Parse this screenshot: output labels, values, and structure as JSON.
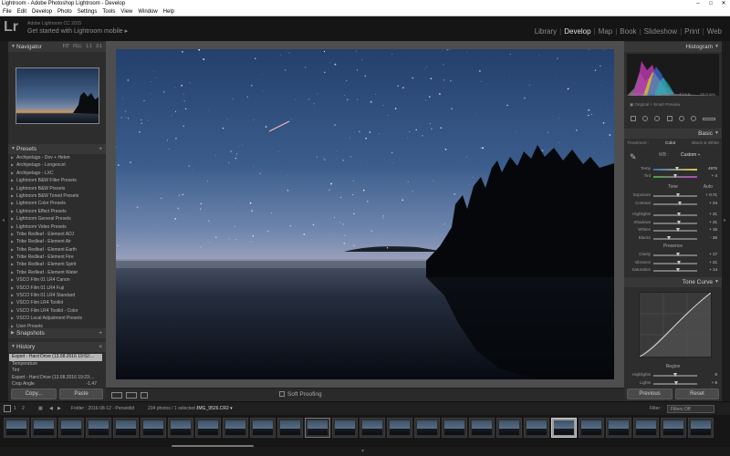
{
  "window": {
    "title": "Lightroom - Adobe Photoshop Lightroom - Develop",
    "controls": [
      "–",
      "□",
      "✕"
    ]
  },
  "menu": [
    "File",
    "Edit",
    "Develop",
    "Photo",
    "Settings",
    "Tools",
    "View",
    "Window",
    "Help"
  ],
  "identity": {
    "logo": "Lr",
    "product": "Adobe Lightroom CC 2015",
    "subtitle": "Get started with Lightroom mobile ▸"
  },
  "modules": [
    "Library",
    "Develop",
    "Map",
    "Book",
    "Slideshow",
    "Print",
    "Web"
  ],
  "active_module": "Develop",
  "left": {
    "navigator": {
      "title": "Navigator",
      "options": [
        "FIT",
        "FILL",
        "1:1",
        "3:1"
      ]
    },
    "presets_title": "Presets",
    "presets": [
      "Archipelago - Dov + Helen",
      "Archipelago - Longexcel",
      "Archipelago - LXC",
      "Lightroom B&W Filter Presets",
      "Lightroom B&W Presets",
      "Lightroom B&W Toned Presets",
      "Lightroom Color Presets",
      "Lightroom Effect Presets",
      "Lightroom General Presets",
      "Lightroom Video Presets",
      "Tribe Redleaf - Element ADJ",
      "Tribe Redleaf - Element Air",
      "Tribe Redleaf - Element Earth",
      "Tribe Redleaf - Element Fire",
      "Tribe Redleaf - Element Spirit",
      "Tribe Redleaf - Element Water",
      "VSCO Film 01 LR4 Canon",
      "VSCO Film 01 LR4 Fuji",
      "VSCO Film 01 LR4 Standard",
      "VSCO Film LR4 Toolkit",
      "VSCO Film LR4 Toolkit - Color",
      "VSCO Local Adjustment Presets",
      "User Presets"
    ],
    "snapshots_title": "Snapshots",
    "history_title": "History",
    "history": [
      "Export - Hard Drive (13.08.2016 19:52:...",
      "Temperature",
      "Tint",
      "Export - Hard Drive (13.08.2016 19:23:...",
      "Crop Angle"
    ],
    "history_values": [
      "",
      "",
      "",
      "",
      "-1.47"
    ],
    "copy_label": "Copy...",
    "paste_label": "Paste"
  },
  "toolbar": {
    "soft_proofing": "Soft Proofing"
  },
  "right": {
    "histogram_title": "Histogram",
    "histo_info": [
      "ISO 3200",
      "14 mm",
      "f / 2.8",
      "15.0 sec"
    ],
    "preview_label": "Original + Smart Preview",
    "basic_title": "Basic",
    "treatment_label": "Treatment :",
    "treatment_opts": [
      "Color",
      "Black & White"
    ],
    "wb_label": "WB :",
    "wb_value": "Custom ÷",
    "temp": {
      "label": "Temp",
      "value": "4976",
      "pos": 0.55
    },
    "tint": {
      "label": "Tint",
      "value": "+ 4",
      "pos": 0.52
    },
    "tone_label": "Tone",
    "auto_label": "Auto",
    "tone": [
      {
        "label": "Exposure",
        "value": "+ 0.71",
        "pos": 0.57
      },
      {
        "label": "Contrast",
        "value": "+ 24",
        "pos": 0.62
      }
    ],
    "tone2": [
      {
        "label": "Highlights",
        "value": "+ 21",
        "pos": 0.6
      },
      {
        "label": "Shadows",
        "value": "+ 21",
        "pos": 0.6
      },
      {
        "label": "Whites",
        "value": "+ 16",
        "pos": 0.58
      },
      {
        "label": "Blacks",
        "value": "- 26",
        "pos": 0.37
      }
    ],
    "presence_label": "Presence",
    "presence": [
      {
        "label": "Clarity",
        "value": "+ 17",
        "pos": 0.58
      },
      {
        "label": "Vibrance",
        "value": "+ 21",
        "pos": 0.6
      },
      {
        "label": "Saturation",
        "value": "+ 14",
        "pos": 0.57
      }
    ],
    "tonecurve_title": "Tone Curve",
    "region_label": "Region",
    "region": [
      {
        "label": "Highlights",
        "value": "0",
        "pos": 0.5
      },
      {
        "label": "Lights",
        "value": "+ 8",
        "pos": 0.54
      }
    ],
    "previous_label": "Previous",
    "reset_label": "Reset"
  },
  "filmbar": {
    "pages": [
      "1",
      "2"
    ],
    "folder": "Folder : 2016-08-12 - Perseidid",
    "count": "234 photos / 1 selected /",
    "file": "IMG_9526.CR2 ▾",
    "filter_label": "Filter :",
    "filter_value": "Filters Off"
  },
  "film_count": 26,
  "film_selected": 20,
  "film_active": 11,
  "colors": {
    "accent": "#e0e0e0",
    "panel": "#2d2d2d",
    "selected_history": "#b6b6b6"
  }
}
